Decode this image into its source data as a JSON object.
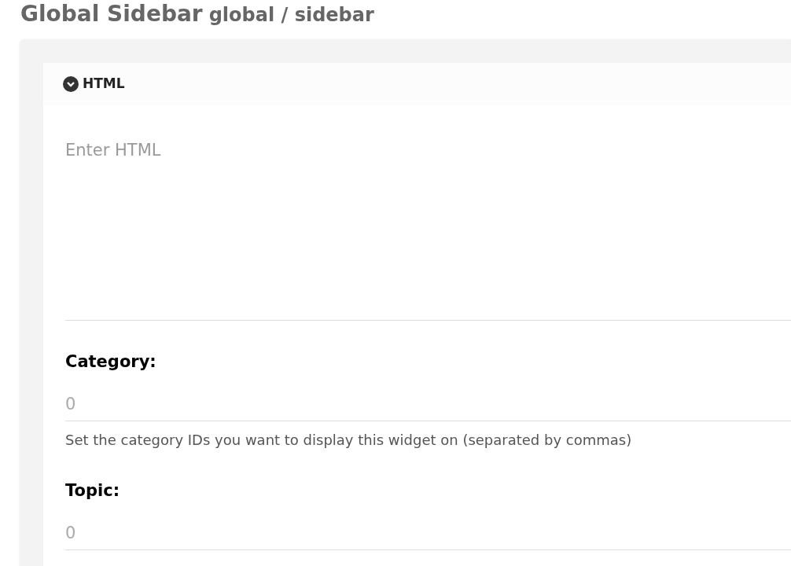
{
  "page_title": {
    "name": "Global Sidebar",
    "path": "global / sidebar"
  },
  "section": {
    "title": "HTML",
    "expanded": true
  },
  "html_field": {
    "placeholder": "Enter HTML"
  },
  "fields": [
    {
      "label": "Category:",
      "placeholder": "0",
      "help": "Set the category IDs you want to display this widget on (separated by commas)"
    },
    {
      "label": "Topic:",
      "placeholder": "0"
    }
  ]
}
